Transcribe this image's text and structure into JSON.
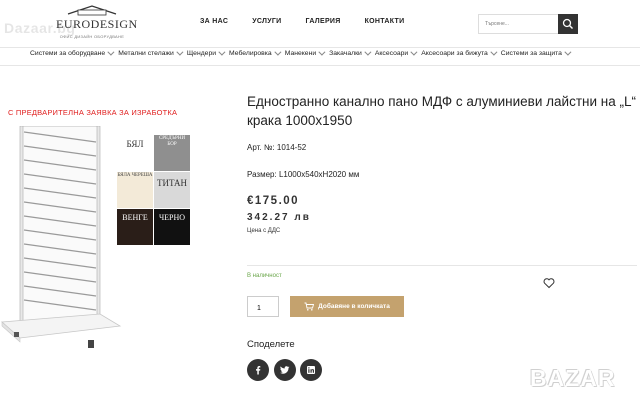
{
  "brand": {
    "logo_text": "EURODESIGN",
    "logo_tagline": "ОФИС ДИЗАЙН ОБОРУДВАНЕ",
    "watermark": "Dazaar.bg"
  },
  "top_nav": {
    "items": [
      "ЗА НАС",
      "УСЛУГИ",
      "ГАЛЕРИЯ",
      "КОНТАКТИ"
    ]
  },
  "search": {
    "placeholder": "Търсене...",
    "icon": "search-icon"
  },
  "category_nav": {
    "items": [
      "Системи за оборудване",
      "Метални стелажи",
      "Щендери",
      "Мебелировка",
      "Манекени",
      "Закачалки",
      "Аксесоари",
      "Аксесоари за бижута",
      "Системи за защита"
    ]
  },
  "product": {
    "preorder_note": "С ПРЕДВАРИТЕЛНА ЗАЯВКА ЗА ИЗРАБОТКА",
    "title": "Едностранно канално пано МДФ с алуминиеви лайстни на „L“ крака 1000х1950",
    "sku_label": "Арт. №:",
    "sku": "1014-52",
    "size_label": "Размер:",
    "size": "L1000x540xH2020 мм",
    "price_eur": "€175.00",
    "price_bgn": "342.27 лв",
    "vat_note": "Цена с ДДС",
    "stock_status": "В наличност",
    "quantity": "1",
    "add_to_cart_label": "Добавяне в количката"
  },
  "swatches": [
    {
      "label": "БЯЛ",
      "color": "#ffffff"
    },
    {
      "label": "СРЕДЪРНИ БОР",
      "color": "#8f8f8f"
    },
    {
      "label": "БЯЛА ЧЕРЕША",
      "color": "#f3ead8"
    },
    {
      "label": "ТИТАН",
      "color": "#d9d9d9"
    },
    {
      "label": "ВЕНГЕ",
      "color": "#2a1e18"
    },
    {
      "label": "ЧЕРНО",
      "color": "#111111"
    }
  ],
  "share": {
    "title": "Споделете",
    "icons": [
      "facebook-icon",
      "twitter-icon",
      "linkedin-icon"
    ]
  },
  "footer_watermark": "BAZAR",
  "colors": {
    "accent_gold": "#c4a26e",
    "preorder_red": "#e02020",
    "stock_green": "#6aa64a",
    "dark": "#333333"
  }
}
